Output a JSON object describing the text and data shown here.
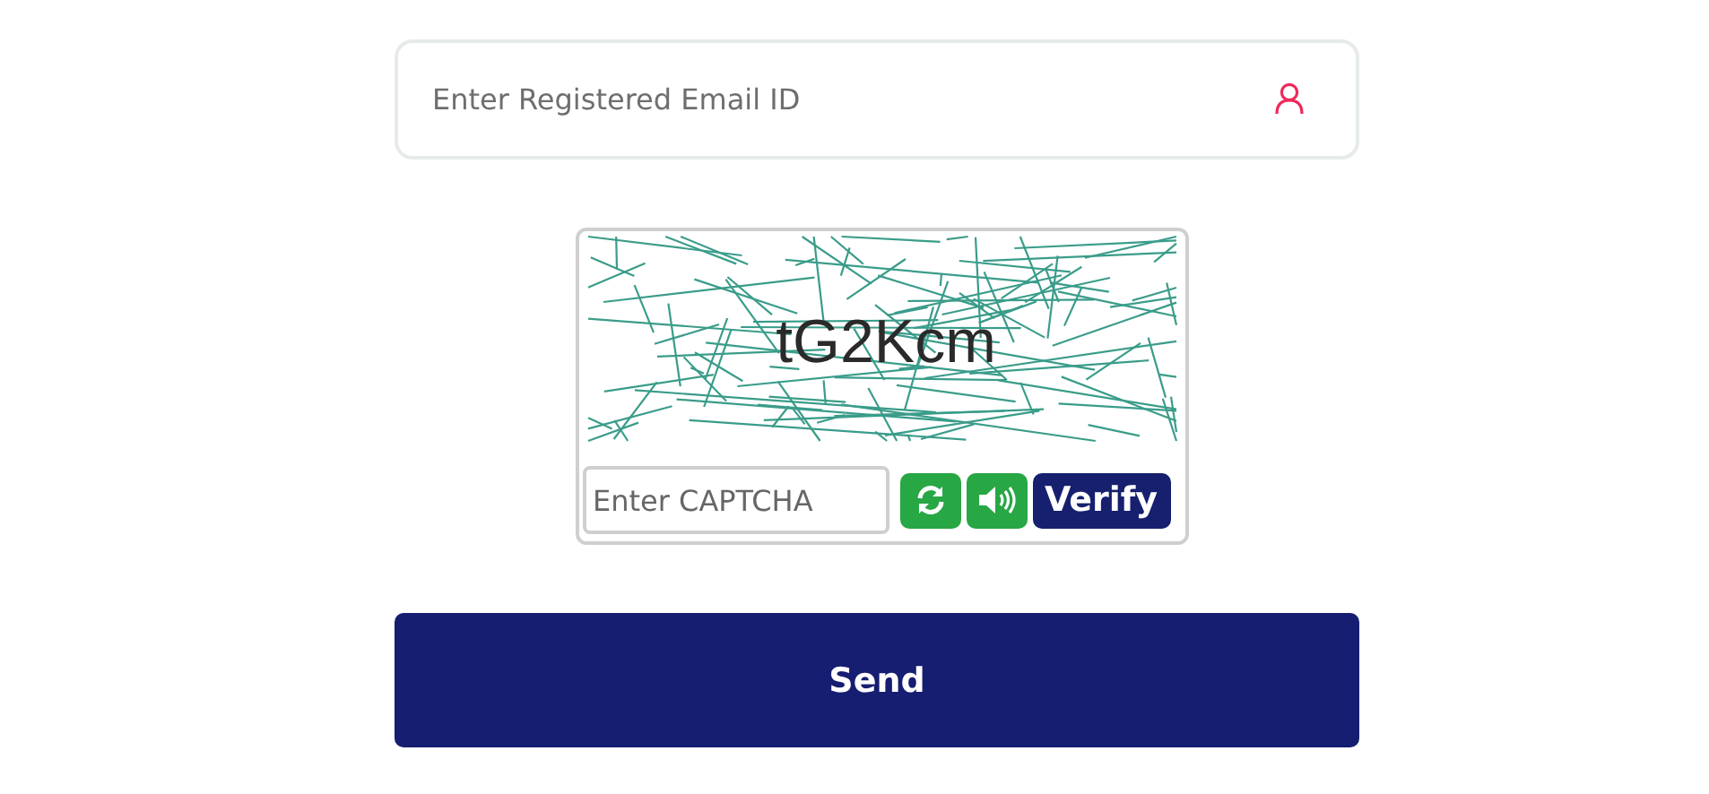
{
  "email_field": {
    "placeholder": "Enter Registered Email ID"
  },
  "captcha": {
    "code": "tG2Kcm",
    "input": {
      "placeholder": "Enter CAPTCHA"
    },
    "verify_button": "Verify"
  },
  "send_button": "Send"
}
